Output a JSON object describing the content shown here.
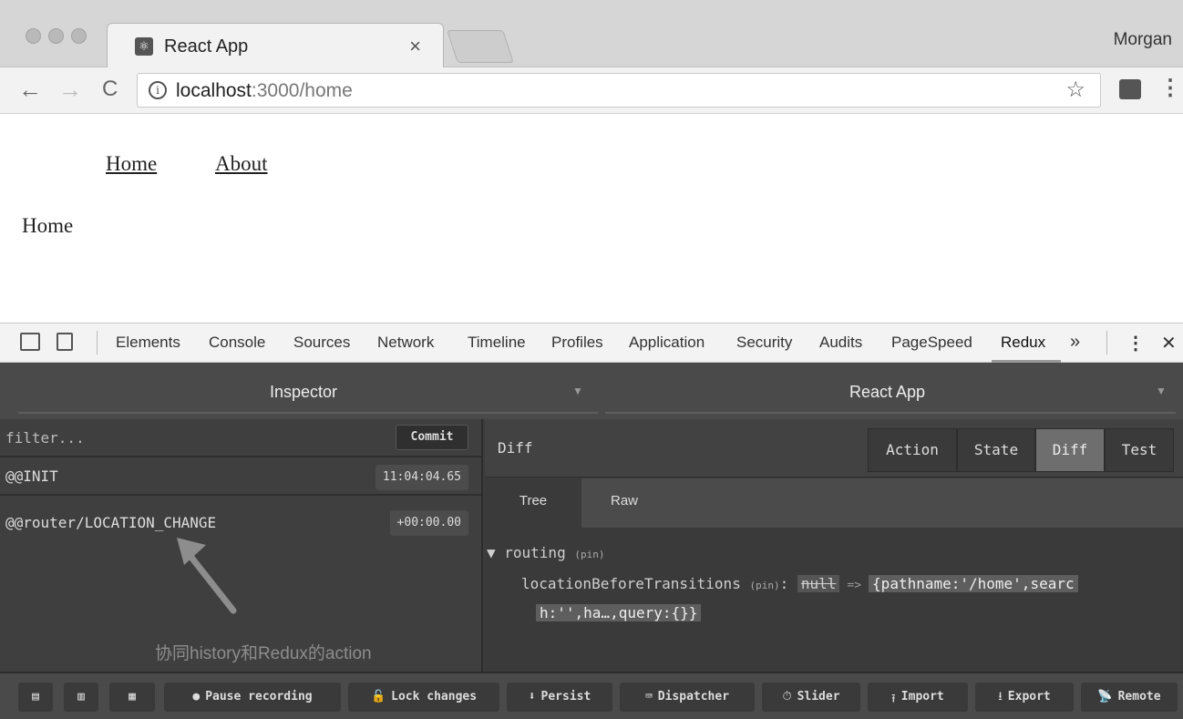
{
  "browser": {
    "tab_title": "React App",
    "tab_close": "×",
    "profile_name": "Morgan",
    "nav": {
      "back": "←",
      "forward": "→",
      "reload": "C"
    },
    "url_host": "localhost",
    "url_path": ":3000/home",
    "info_icon": "i",
    "star_icon": "☆",
    "menu_icon": "⋮"
  },
  "page": {
    "links": [
      "Home",
      "About"
    ],
    "heading": "Home"
  },
  "devtools": {
    "tabs": [
      "Elements",
      "Console",
      "Sources",
      "Network",
      "Timeline",
      "Profiles",
      "Application",
      "Security",
      "Audits",
      "PageSpeed",
      "Redux"
    ],
    "active_tab": "Redux",
    "more": "»",
    "menu": "⋮",
    "close": "✕"
  },
  "redux": {
    "inspector_title": "Inspector",
    "app_title": "React App",
    "filter_placeholder": "filter...",
    "commit_label": "Commit",
    "actions": [
      {
        "name": "@@INIT",
        "time": "11:04:04.65"
      },
      {
        "name": "@@router/LOCATION_CHANGE",
        "time": "+00:00.00"
      }
    ],
    "annotation": "协同history和Redux的action",
    "diff_label": "Diff",
    "segments": [
      "Action",
      "State",
      "Diff",
      "Test"
    ],
    "active_segment": "Diff",
    "subtabs": [
      "Tree",
      "Raw"
    ],
    "active_subtab": "Tree",
    "tree": {
      "root_key": "routing",
      "pin": "(pin)",
      "child_key": "locationBeforeTransitions",
      "old_value": "null",
      "arrow": "=>",
      "new_value_line1": "{pathname:'/home',searc",
      "new_value_line2": "h:'',ha…,query:{}}"
    },
    "bottom_buttons": [
      {
        "label": "",
        "icon": "▤"
      },
      {
        "label": "",
        "icon": "▥"
      },
      {
        "label": "",
        "icon": "▦"
      },
      {
        "label": "Pause recording",
        "icon": "●"
      },
      {
        "label": "Lock changes",
        "icon": "🔓"
      },
      {
        "label": "Persist",
        "icon": "⬇"
      },
      {
        "label": "Dispatcher",
        "icon": "⌨"
      },
      {
        "label": "Slider",
        "icon": "⏱"
      },
      {
        "label": "Import",
        "icon": "⭳"
      },
      {
        "label": "Export",
        "icon": "⭳"
      },
      {
        "label": "Remote",
        "icon": "📡"
      }
    ]
  }
}
